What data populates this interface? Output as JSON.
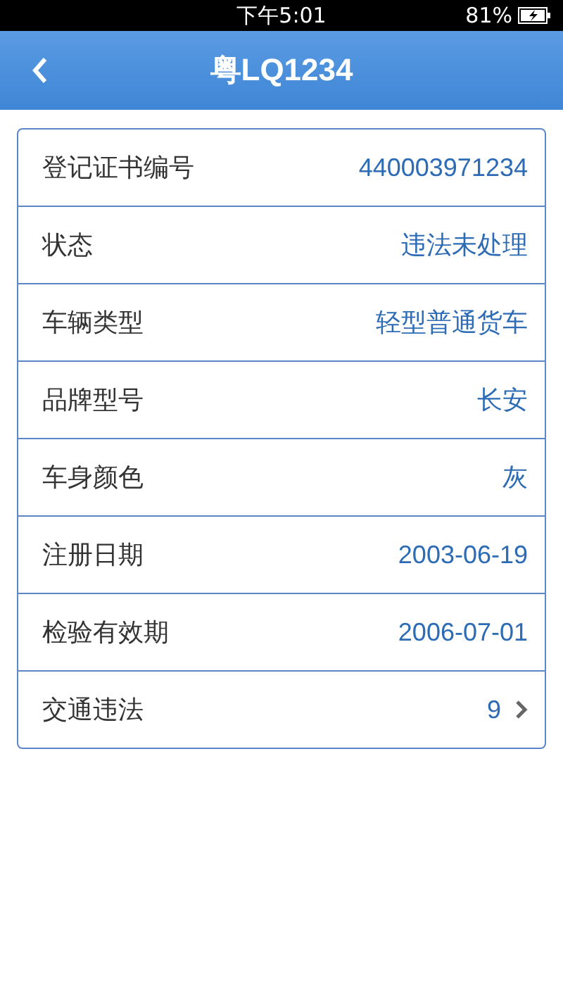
{
  "status_bar": {
    "time": "下午5:01",
    "battery": "81%"
  },
  "nav_bar": {
    "title": "粤LQ1234"
  },
  "rows": [
    {
      "label": "登记证书编号",
      "value": "440003971234",
      "kind": "plain"
    },
    {
      "label": "状态",
      "value": "违法未处理",
      "kind": "plain"
    },
    {
      "label": "车辆类型",
      "value": "轻型普通货车",
      "kind": "plain"
    },
    {
      "label": "品牌型号",
      "value": "长安",
      "kind": "plain"
    },
    {
      "label": "车身颜色",
      "value": "灰",
      "kind": "plain"
    },
    {
      "label": "注册日期",
      "value": "2003-06-19",
      "kind": "plain"
    },
    {
      "label": "检验有效期",
      "value": "2006-07-01",
      "kind": "plain"
    },
    {
      "label": "交通违法",
      "value": "9",
      "kind": "link"
    }
  ]
}
